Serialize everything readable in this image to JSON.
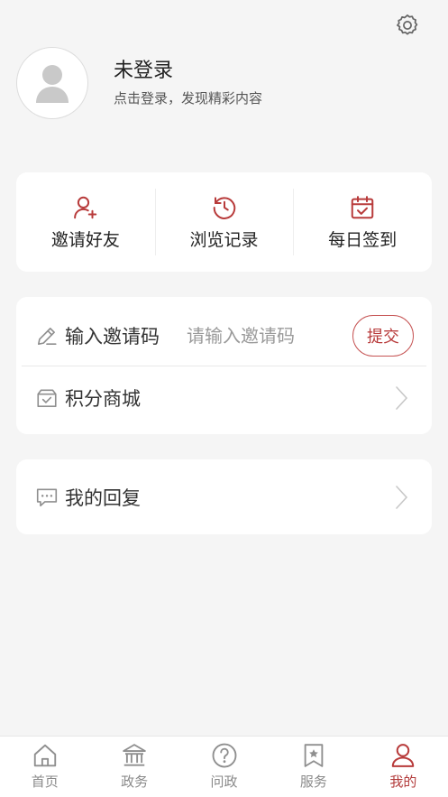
{
  "header": {
    "settings_icon": "gear-icon"
  },
  "profile": {
    "name": "未登录",
    "subtitle": "点击登录，发现精彩内容",
    "avatar_icon": "user-silhouette-icon"
  },
  "quick_actions": [
    {
      "label": "邀请好友",
      "icon": "add-user-icon"
    },
    {
      "label": "浏览记录",
      "icon": "clock-history-icon"
    },
    {
      "label": "每日签到",
      "icon": "calendar-check-icon"
    }
  ],
  "invite": {
    "label": "输入邀请码",
    "placeholder": "请输入邀请码",
    "value": "",
    "submit_label": "提交"
  },
  "shop": {
    "label": "积分商城"
  },
  "reply": {
    "label": "我的回复"
  },
  "tabs": [
    {
      "label": "首页",
      "icon": "home-icon",
      "active": false
    },
    {
      "label": "政务",
      "icon": "government-building-icon",
      "active": false
    },
    {
      "label": "问政",
      "icon": "question-circle-icon",
      "active": false
    },
    {
      "label": "服务",
      "icon": "bookmark-star-icon",
      "active": false
    },
    {
      "label": "我的",
      "icon": "user-icon",
      "active": true
    }
  ],
  "colors": {
    "accent": "#b83b3b",
    "background": "#f5f5f5",
    "icon_gray": "#8f8f8f"
  }
}
